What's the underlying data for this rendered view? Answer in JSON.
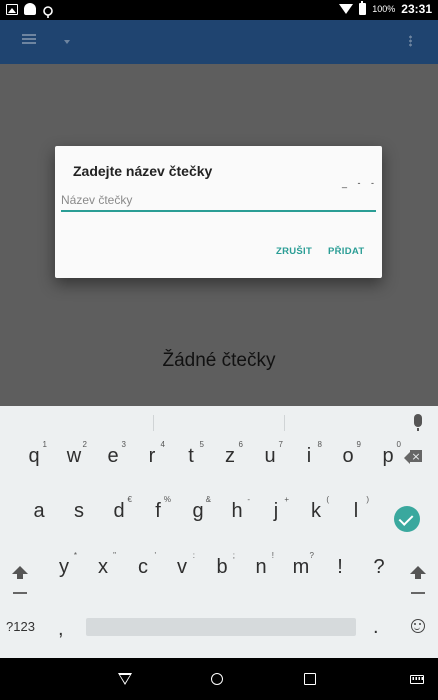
{
  "status_bar": {
    "time": "23:31",
    "battery": "100%"
  },
  "dialog": {
    "title": "Zadejte název čtečky",
    "input_placeholder": "Název čtečky",
    "input_value": "",
    "trailing_marks": "_ - -",
    "cancel_label": "ZRUŠIT",
    "add_label": "PŘIDAT"
  },
  "empty_state": {
    "text": "Žádné čtečky"
  },
  "keyboard": {
    "row1": [
      {
        "key": "q",
        "hint": "1"
      },
      {
        "key": "w",
        "hint": "2"
      },
      {
        "key": "e",
        "hint": "3"
      },
      {
        "key": "r",
        "hint": "4"
      },
      {
        "key": "t",
        "hint": "5"
      },
      {
        "key": "z",
        "hint": "6"
      },
      {
        "key": "u",
        "hint": "7"
      },
      {
        "key": "i",
        "hint": "8"
      },
      {
        "key": "o",
        "hint": "9"
      },
      {
        "key": "p",
        "hint": "0"
      }
    ],
    "row2": [
      {
        "key": "a",
        "hint": ""
      },
      {
        "key": "s",
        "hint": ""
      },
      {
        "key": "d",
        "hint": "€"
      },
      {
        "key": "f",
        "hint": "%"
      },
      {
        "key": "g",
        "hint": "&"
      },
      {
        "key": "h",
        "hint": "-"
      },
      {
        "key": "j",
        "hint": "+"
      },
      {
        "key": "k",
        "hint": "("
      },
      {
        "key": "l",
        "hint": ")"
      }
    ],
    "row3": [
      {
        "key": "y",
        "hint": "*"
      },
      {
        "key": "x",
        "hint": "\""
      },
      {
        "key": "c",
        "hint": "'"
      },
      {
        "key": "v",
        "hint": ":"
      },
      {
        "key": "b",
        "hint": ";"
      },
      {
        "key": "n",
        "hint": "!"
      },
      {
        "key": "m",
        "hint": "?"
      },
      {
        "key": "!",
        "hint": ""
      },
      {
        "key": "?",
        "hint": ""
      }
    ],
    "symbols_label": "?123",
    "comma": ",",
    "period": "."
  },
  "icons": {
    "status_left": [
      "image-icon",
      "android-icon",
      "debug-icon"
    ],
    "status_right": [
      "wifi-icon",
      "battery-icon"
    ],
    "app_bar": [
      "menu-icon",
      "dropdown-arrow-icon",
      "overflow-menu-icon"
    ],
    "keyboard": [
      "mic-icon",
      "backspace-icon",
      "enter-check-icon",
      "shift-icon",
      "emoji-icon"
    ],
    "nav": [
      "back-icon",
      "home-icon",
      "recents-icon",
      "keyboard-switch-icon"
    ]
  },
  "colors": {
    "accent": "#2a9d95",
    "app_bar": "#1f4470",
    "scrim": "#5e5e5e",
    "enter_key": "#3aa89e"
  }
}
